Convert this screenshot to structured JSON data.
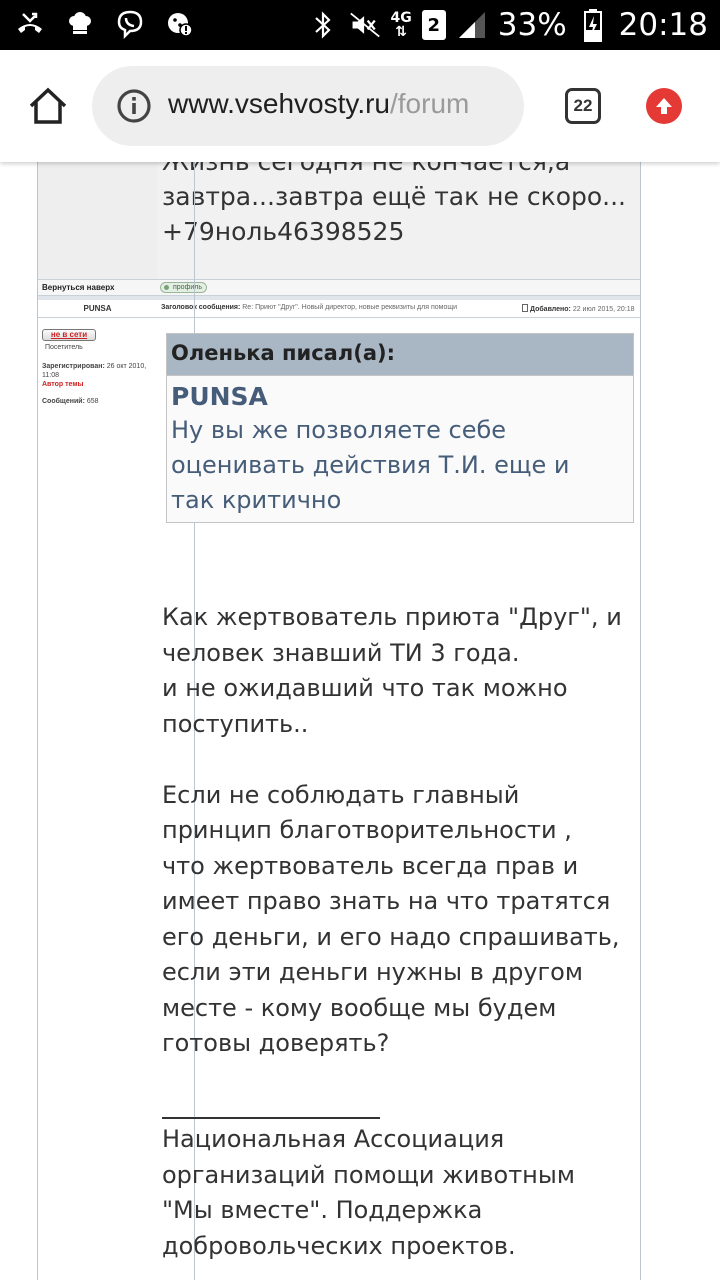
{
  "status_bar": {
    "network": "4G",
    "sim": "2",
    "battery": "33%",
    "time": "20:18"
  },
  "toolbar": {
    "url_host": "www.vsehvosty.ru",
    "url_path": "/forum",
    "tab_count": "22"
  },
  "previous_post": {
    "lines": [
      "Жизнь сегодня не кончается,а",
      "завтра...завтра ещё так не скоро...",
      "+79ноль46398525"
    ],
    "back_to_top": "Вернуться наверх",
    "profile_label": "профиль"
  },
  "post": {
    "author": "PUNSA",
    "subject_label": "Заголовок сообщения:",
    "subject": "Re: Приют \"Друг\". Новый директор, новые реквизиты для помощи",
    "posted_label": "Добавлено:",
    "posted": "22 июл 2015, 20:18",
    "user": {
      "status": "не в сети",
      "rank": "Посетитель",
      "registered_label": "Зарегистрирован:",
      "registered": "26 окт 2010, 11:08",
      "topic_author": "Автор темы",
      "messages_label": "Сообщений:",
      "messages": "658"
    },
    "quote": {
      "header": "Оленька писал(а):",
      "name": "PUNSA",
      "lines": [
        "Ну вы же позволяете себе",
        "оценивать действия Т.И. еще и",
        "так критично"
      ]
    },
    "message_lines": [
      "Как жертвователь приюта \"Друг\", и",
      "человек знавший ТИ 3 года.",
      "и не ожидавший что так можно",
      "поступить..",
      "",
      "Если не соблюдать главный",
      "принцип благотворительности ,",
      "что жертвователь всегда прав и",
      "имеет право знать на что тратятся",
      "его деньги, и его надо спрашивать,",
      "если эти деньги нужны в другом",
      "месте - кому вообще мы будем",
      "готовы доверять?"
    ],
    "signature_lines": [
      "Национальная Ассоциация",
      "организаций помощи животным",
      "\"Мы вместе\". Поддержка",
      "добровольческих проектов."
    ]
  }
}
